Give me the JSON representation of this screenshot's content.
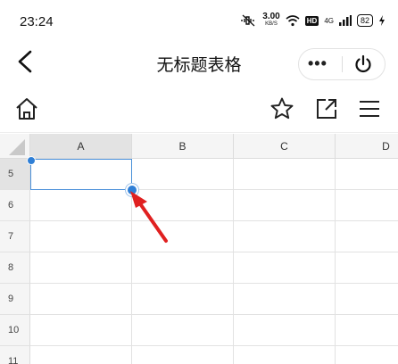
{
  "status_bar": {
    "time": "23:24",
    "speed_value": "3.00",
    "speed_unit": "KB/S",
    "hd_badge": "HD",
    "network": "4G",
    "battery": "82"
  },
  "title_bar": {
    "title": "无标题表格",
    "more_label": "•••"
  },
  "spreadsheet": {
    "columns": [
      "A",
      "B",
      "C",
      "D"
    ],
    "rows": [
      "5",
      "6",
      "7",
      "8",
      "9",
      "10",
      "11"
    ],
    "selected_cell": "A5"
  },
  "colors": {
    "selection": "#4a90d9",
    "handle": "#2f7fd6",
    "arrow": "#e02020"
  }
}
